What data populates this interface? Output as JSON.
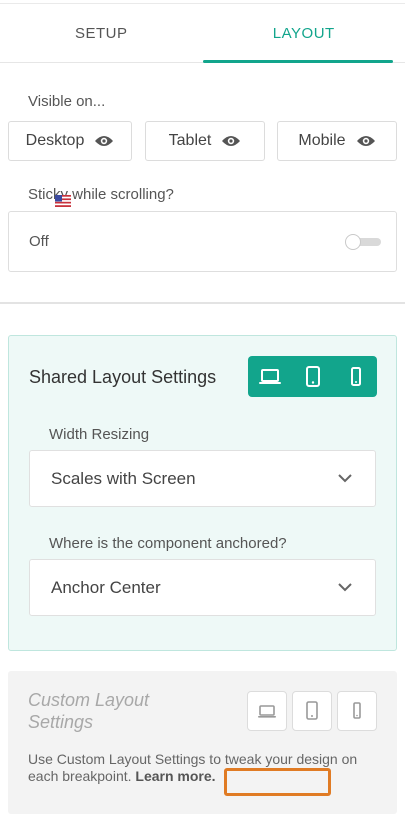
{
  "tabs": [
    {
      "label": "SETUP"
    },
    {
      "label": "LAYOUT"
    }
  ],
  "visible_on": {
    "label": "Visible on...",
    "buttons": [
      {
        "label": "Desktop",
        "icon": "eye-icon"
      },
      {
        "label": "Tablet",
        "icon": "eye-icon"
      },
      {
        "label": "Mobile",
        "icon": "eye-icon"
      }
    ]
  },
  "sticky": {
    "label": "Sticky while scrolling?",
    "value": "Off",
    "enabled": false
  },
  "shared": {
    "title": "Shared Layout Settings",
    "devices": [
      "laptop-icon",
      "tablet-icon",
      "mobile-icon"
    ],
    "width_label": "Width Resizing",
    "width_value": "Scales with Screen",
    "anchor_label": "Where is the component anchored?",
    "anchor_value": "Anchor Center"
  },
  "custom": {
    "title": "Custom Layout Settings",
    "devices": [
      "laptop-icon",
      "tablet-icon",
      "mobile-icon"
    ],
    "description": "Use Custom Layout Settings to tweak your design on each breakpoint.",
    "learn_more": "Learn more."
  },
  "colors": {
    "accent": "#12a58c",
    "shared_bg": "#eef9f7",
    "custom_bg": "#f3f3f3",
    "highlight": "#e07b24"
  }
}
